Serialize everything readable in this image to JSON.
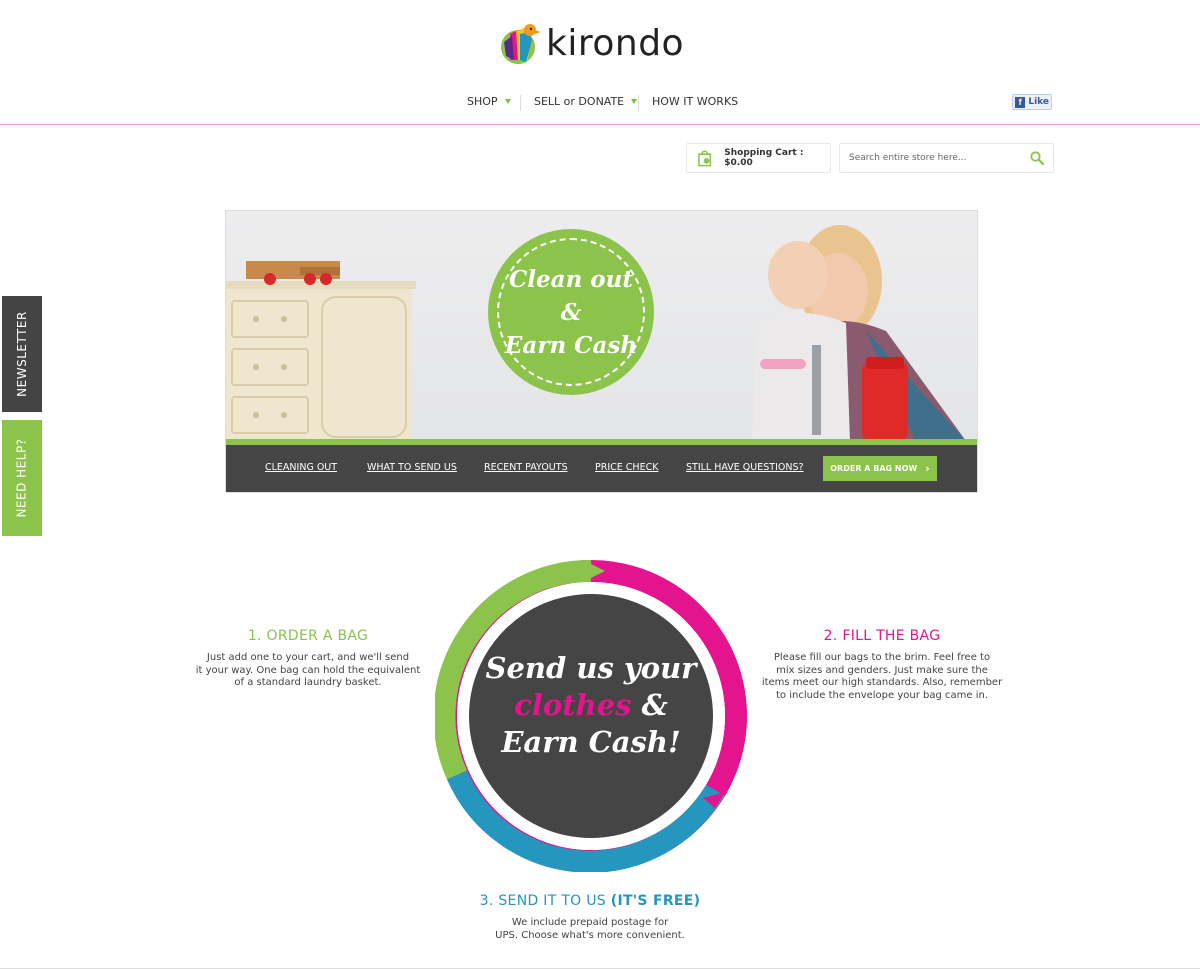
{
  "brand": {
    "name": "kirondo"
  },
  "nav": {
    "shop": "SHOP",
    "sell": "SELL or DONATE",
    "how": "HOW IT WORKS"
  },
  "facebook": {
    "like_label": "Like",
    "icon": "facebook-f-icon"
  },
  "cart": {
    "label": "Shopping Cart : $0.00",
    "icon": "shopping-bag-icon"
  },
  "search": {
    "placeholder": "Search entire store here...",
    "icon": "search-icon"
  },
  "side_tabs": {
    "newsletter": "NEWSLETTER",
    "need_help": "NEED HELP?"
  },
  "banner": {
    "badge_lines": [
      "Clean out",
      "&",
      "Earn Cash"
    ],
    "links": [
      "CLEANING OUT",
      "WHAT TO SEND US",
      "RECENT PAYOUTS",
      "PRICE CHECK",
      "STILL HAVE QUESTIONS?"
    ],
    "cta": "ORDER A BAG NOW"
  },
  "steps": {
    "one": {
      "title": "1. ORDER A BAG",
      "text": [
        "Just add one to your cart, and we'll send",
        "it your way. One bag can hold the equivalent",
        "of a standard laundry basket."
      ]
    },
    "two": {
      "title": "2. FILL THE BAG",
      "text": [
        "Please fill our bags to the brim. Feel free to",
        "mix sizes and genders. Just make sure the",
        "items meet our high standards. Also, remember",
        "to include the envelope your bag came in."
      ]
    },
    "three": {
      "title": "3. SEND IT TO US",
      "title_bold": "(IT'S FREE)",
      "text": [
        "We include prepaid postage for",
        "UPS. Choose what's more convenient."
      ]
    }
  },
  "center": {
    "line1": "Send us your",
    "line2_pink": "clothes",
    "line2_rest": " &",
    "line3": "Earn Cash!"
  },
  "colors": {
    "green": "#8cc34b",
    "pink": "#e4148f",
    "blue": "#2596be",
    "dark": "#454545"
  }
}
